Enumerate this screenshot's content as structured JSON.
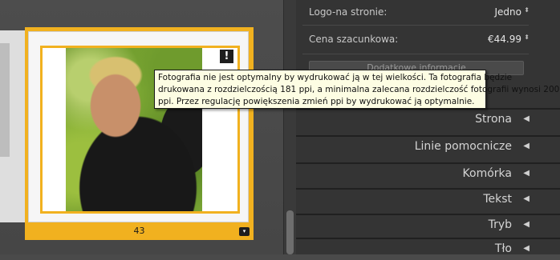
{
  "page": {
    "number": "43",
    "warning_badge": "!",
    "menu_glyph": "▾"
  },
  "panel": {
    "logo_row": {
      "label": "Logo-na stronie:",
      "value": "Jedno"
    },
    "price_row": {
      "label": "Cena szacunkowa:",
      "value": "€44.99"
    },
    "more_info_button": "Dodatkowe informacje",
    "stepper_glyph": "⬍",
    "sections": [
      {
        "label": "Strona",
        "arrow": "◀"
      },
      {
        "label": "Linie pomocnicze",
        "arrow": "◀"
      },
      {
        "label": "Komórka",
        "arrow": "◀"
      },
      {
        "label": "Tekst",
        "arrow": "◀"
      },
      {
        "label": "Tryb",
        "arrow": "◀"
      },
      {
        "label": "Tło",
        "arrow": "◀"
      }
    ]
  },
  "tooltip": {
    "line1": "Fotografia nie jest optymalny by wydrukować ją w tej wielkości. Ta fotografia będzie",
    "line2": "drukowana z rozdzielczością 181 ppi, a minimalna zalecana rozdzielczość fotografii wynosi 200",
    "line3": "ppi. Przez regulację powiększenia zmień ppi by wydrukować ją optymalnie."
  },
  "colors": {
    "selection_accent": "#f1b11f",
    "panel_bg": "#343434",
    "tooltip_bg": "#fdfde3"
  }
}
